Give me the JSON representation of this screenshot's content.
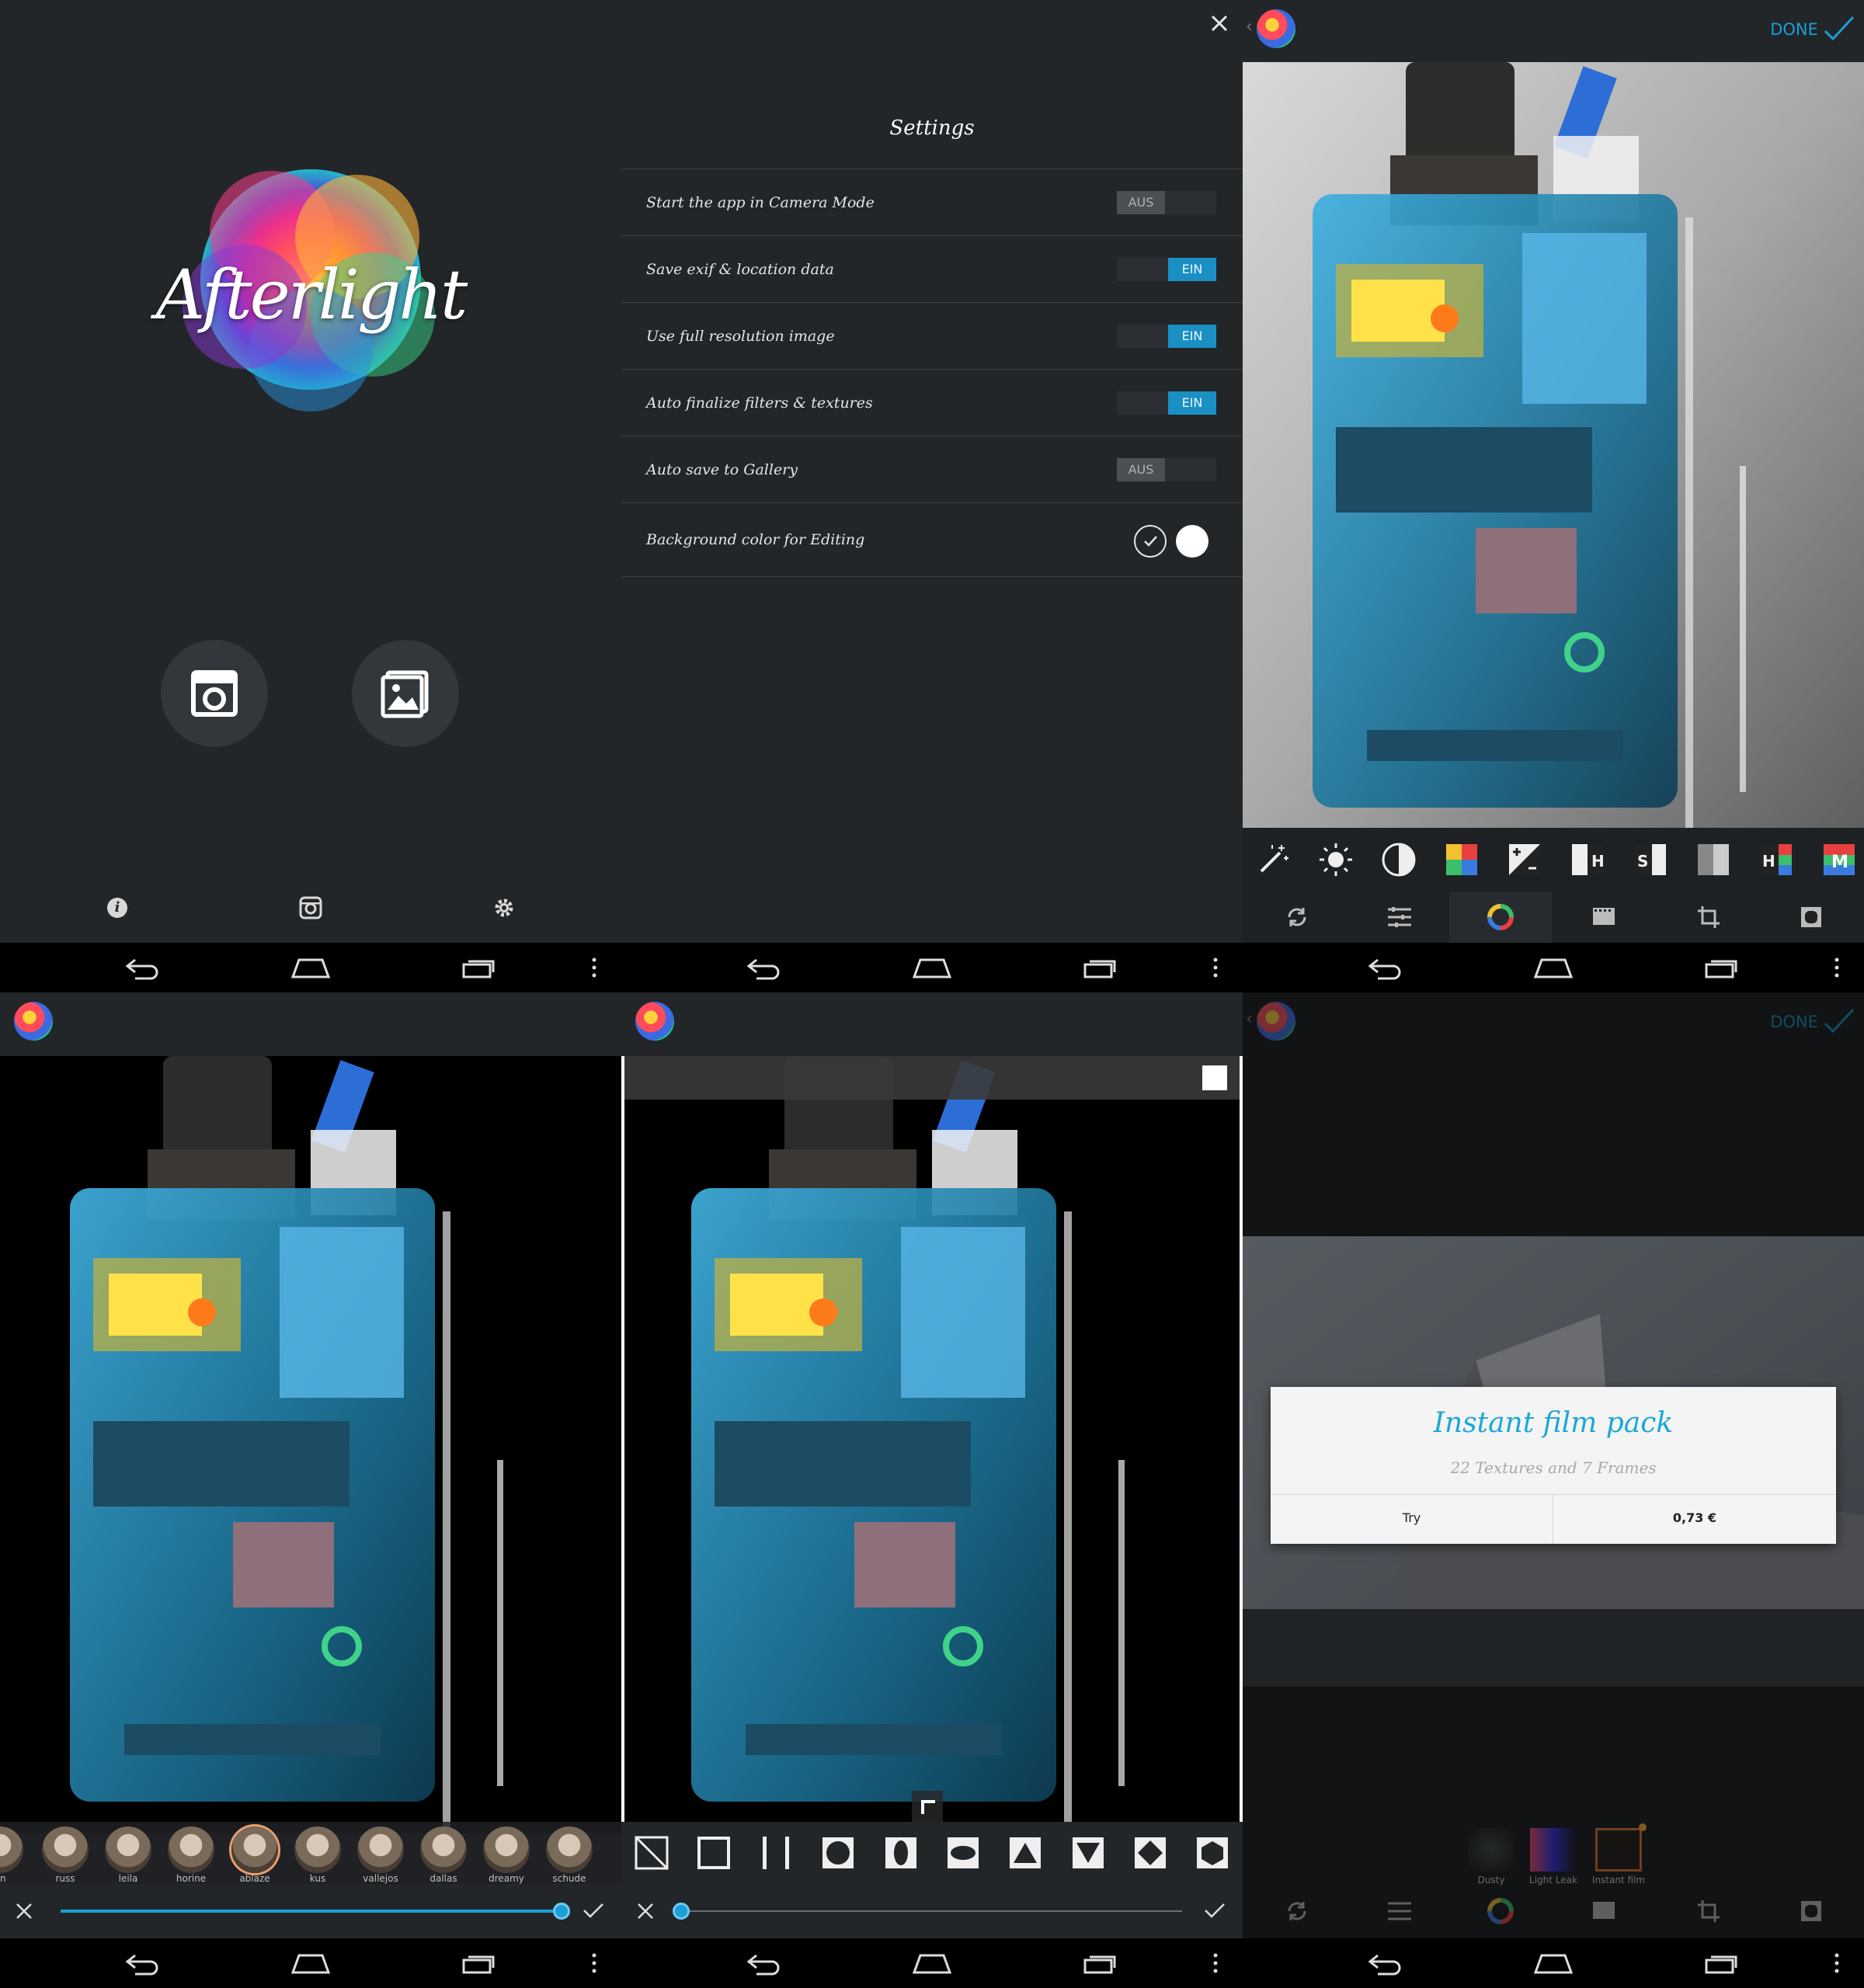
{
  "home": {
    "logo_text": "Afterlight",
    "bottom_icons": [
      "info-icon",
      "instagram-icon",
      "settings-gear-icon"
    ],
    "main_buttons": [
      "camera-icon",
      "gallery-icon"
    ]
  },
  "settings": {
    "title": "Settings",
    "rows": [
      {
        "label": "Start the app in Camera Mode",
        "state": "AUS",
        "on": false
      },
      {
        "label": "Save exif & location data",
        "state": "EIN",
        "on": true
      },
      {
        "label": "Use full resolution image",
        "state": "EIN",
        "on": true
      },
      {
        "label": "Auto finalize filters & textures",
        "state": "EIN",
        "on": true
      },
      {
        "label": "Auto save to Gallery",
        "state": "AUS",
        "on": false
      }
    ],
    "bg_row_label": "Background color for Editing"
  },
  "editor": {
    "done_label": "DONE",
    "tools": [
      "magic-wand-icon",
      "brightness-icon",
      "contrast-icon",
      "saturation-icon",
      "exposure-icon",
      "highlights-icon",
      "shadows-icon",
      "gradient-icon",
      "hue-icon",
      "mixer-icon"
    ],
    "tool_letters": {
      "highlights": "H",
      "shadows": "S",
      "hue": "H",
      "mixer": "M"
    },
    "tabs": [
      "rotate-icon",
      "adjust-icon",
      "color-wheel-icon",
      "film-icon",
      "crop-icon",
      "frame-icon"
    ]
  },
  "filters": {
    "items": [
      "nn",
      "russ",
      "leila",
      "horine",
      "ablaze",
      "kus",
      "vallejos",
      "dallas",
      "dreamy",
      "schude"
    ]
  },
  "frames": {
    "shapes": [
      "none-icon",
      "square-icon",
      "bars-icon",
      "circle-icon",
      "oval-vertical-icon",
      "oval-horizontal-icon",
      "triangle-up-icon",
      "triangle-down-icon",
      "diamond-icon",
      "hexagon-icon"
    ]
  },
  "store": {
    "done_label": "DONE",
    "title": "Instant film pack",
    "subtitle": "22 Textures and 7 Frames",
    "try_label": "Try",
    "price_label": "0,73 €",
    "textures": [
      {
        "label": "Dusty"
      },
      {
        "label": "Light Leak"
      },
      {
        "label": "Instant film"
      }
    ]
  },
  "colors": {
    "accent": "#1a9fd6",
    "panel_bg": "#222629",
    "nav_bg": "#000000"
  }
}
